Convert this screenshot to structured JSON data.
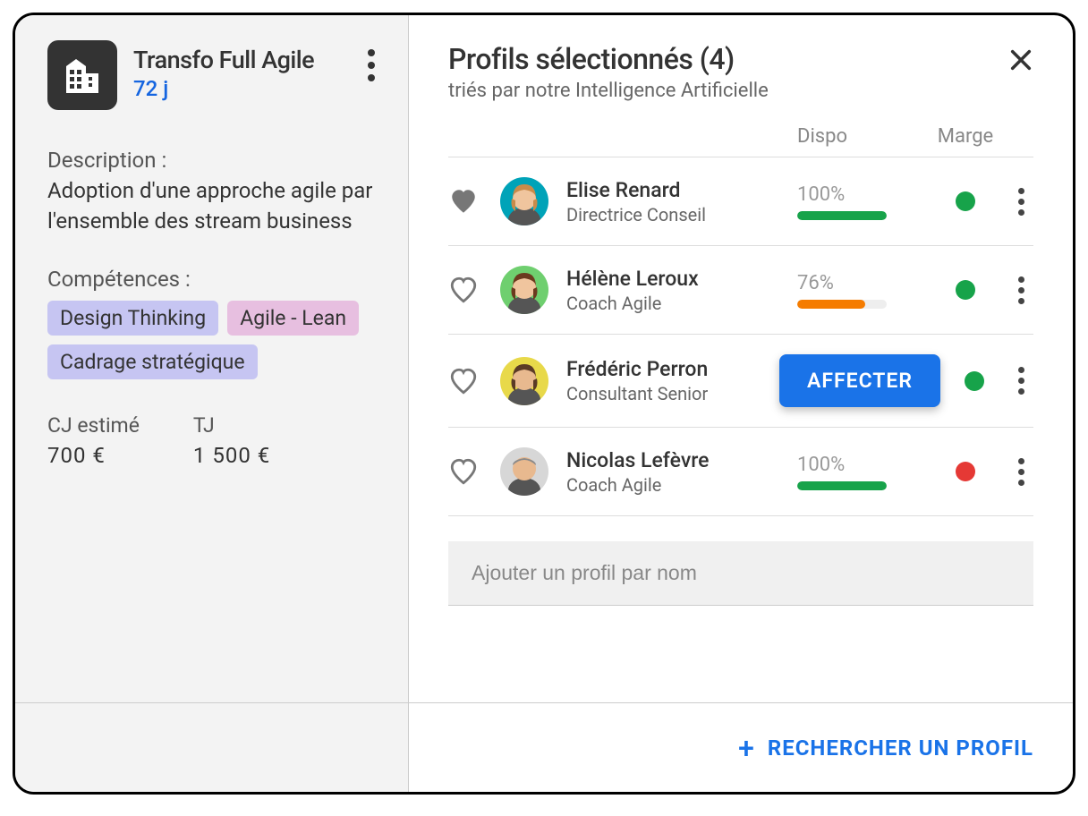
{
  "project": {
    "title": "Transfo Full Agile",
    "days": "72 j",
    "description_label": "Description :",
    "description_text": "Adoption d'une approche agile par l'ensemble des stream business",
    "skills_label": "Compétences :",
    "skills": [
      {
        "label": "Design Thinking",
        "color": "#c6c5f2"
      },
      {
        "label": "Agile - Lean",
        "color": "#e7bfe0"
      },
      {
        "label": "Cadrage stratégique",
        "color": "#c6c5f2"
      }
    ],
    "cj_label": "CJ estimé",
    "cj_value": "700 €",
    "tj_label": "TJ",
    "tj_value": "1 500 €"
  },
  "panel": {
    "title": "Profils sélectionnés (4)",
    "subtitle": "triés par notre Intelligence Artificielle",
    "col_dispo": "Dispo",
    "col_marge": "Marge",
    "add_placeholder": "Ajouter un profil par nom",
    "search_label": "RECHERCHER UN PROFIL",
    "assign_label": "AFFECTER"
  },
  "profiles": [
    {
      "name": "Elise Renard",
      "role": "Directrice Conseil",
      "dispo_pct": "100%",
      "dispo_fill": 100,
      "dispo_color": "#17a34a",
      "marge_color": "#17a34a",
      "favorited": true,
      "show_assign": false
    },
    {
      "name": "Hélène Leroux",
      "role": "Coach Agile",
      "dispo_pct": "76%",
      "dispo_fill": 76,
      "dispo_color": "#f57c00",
      "marge_color": "#17a34a",
      "favorited": false,
      "show_assign": false
    },
    {
      "name": "Frédéric Perron",
      "role": "Consultant Senior",
      "dispo_pct": "",
      "dispo_fill": 0,
      "dispo_color": "#17a34a",
      "marge_color": "#17a34a",
      "favorited": false,
      "show_assign": true
    },
    {
      "name": "Nicolas Lefèvre",
      "role": "Coach Agile",
      "dispo_pct": "100%",
      "dispo_fill": 100,
      "dispo_color": "#17a34a",
      "marge_color": "#e53935",
      "favorited": false,
      "show_assign": false
    }
  ],
  "avatars": [
    {
      "bg": "#00a3b8",
      "skin": "#f0c59e",
      "hair": "#c98b4a"
    },
    {
      "bg": "#6fcf6f",
      "skin": "#f0c59e",
      "hair": "#6b3a1e"
    },
    {
      "bg": "#e8d94a",
      "skin": "#e8b98f",
      "hair": "#5a3a26"
    },
    {
      "bg": "#d7d7d7",
      "skin": "#e8b98f",
      "hair": "#8a8a8a"
    }
  ]
}
